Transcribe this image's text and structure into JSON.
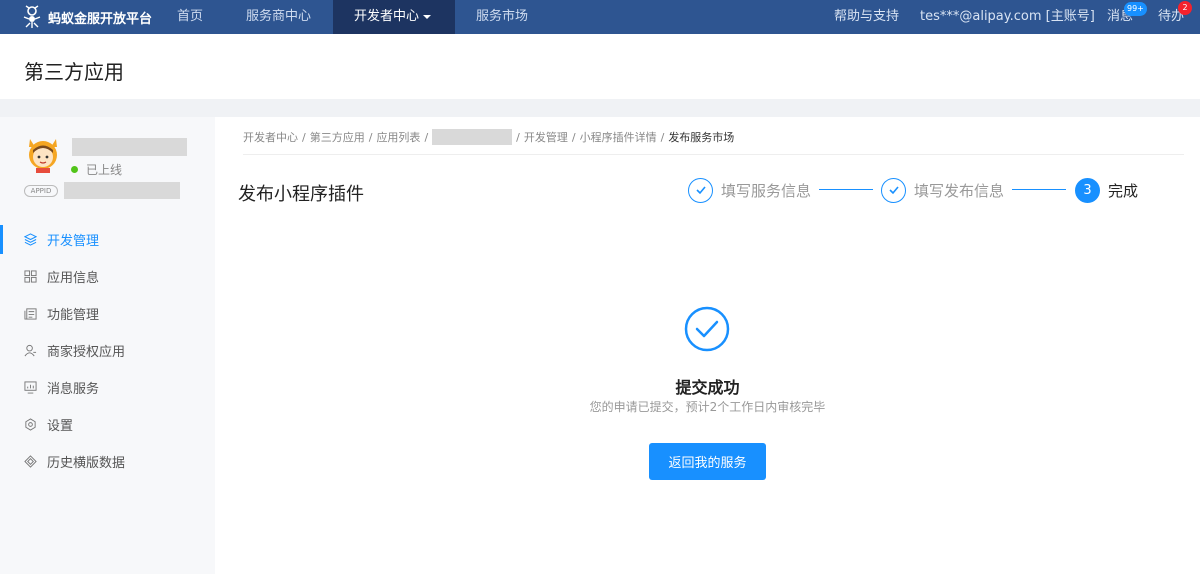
{
  "topnav": {
    "brand": "蚂蚁金服开放平台",
    "items": [
      {
        "label": "首页"
      },
      {
        "label": "服务商中心"
      },
      {
        "label": "开发者中心"
      },
      {
        "label": "服务市场"
      }
    ],
    "help": "帮助与支持",
    "account": "tes***@alipay.com [主账号]",
    "messages": {
      "label": "消息",
      "badge": "99+"
    },
    "todo": {
      "label": "待办",
      "badge": "2"
    }
  },
  "header": {
    "title": "第三方应用"
  },
  "sidebar": {
    "status": "已上线",
    "appid_tag": "APPID",
    "items": [
      {
        "label": "开发管理",
        "icon": "layers-icon"
      },
      {
        "label": "应用信息",
        "icon": "grid-icon"
      },
      {
        "label": "功能管理",
        "icon": "document-stack-icon"
      },
      {
        "label": "商家授权应用",
        "icon": "user-icon"
      },
      {
        "label": "消息服务",
        "icon": "monitor-chart-icon"
      },
      {
        "label": "设置",
        "icon": "gear-icon"
      },
      {
        "label": "历史横版数据",
        "icon": "layers-icon"
      }
    ]
  },
  "breadcrumb": {
    "items": [
      "开发者中心",
      "第三方应用",
      "应用列表"
    ],
    "after": [
      "开发管理",
      "小程序插件详情"
    ],
    "current": "发布服务市场"
  },
  "page": {
    "title": "发布小程序插件"
  },
  "steps": [
    {
      "label": "填写服务信息",
      "state": "done"
    },
    {
      "label": "填写发布信息",
      "state": "done"
    },
    {
      "label": "完成",
      "state": "current",
      "number": "3"
    }
  ],
  "result": {
    "title": "提交成功",
    "description": "您的申请已提交，预计2个工作日内审核完毕",
    "button": "返回我的服务"
  },
  "colors": {
    "nav": "#2e5591",
    "nav_active": "#1d3461",
    "primary": "#1890ff",
    "online": "#52c41a"
  }
}
